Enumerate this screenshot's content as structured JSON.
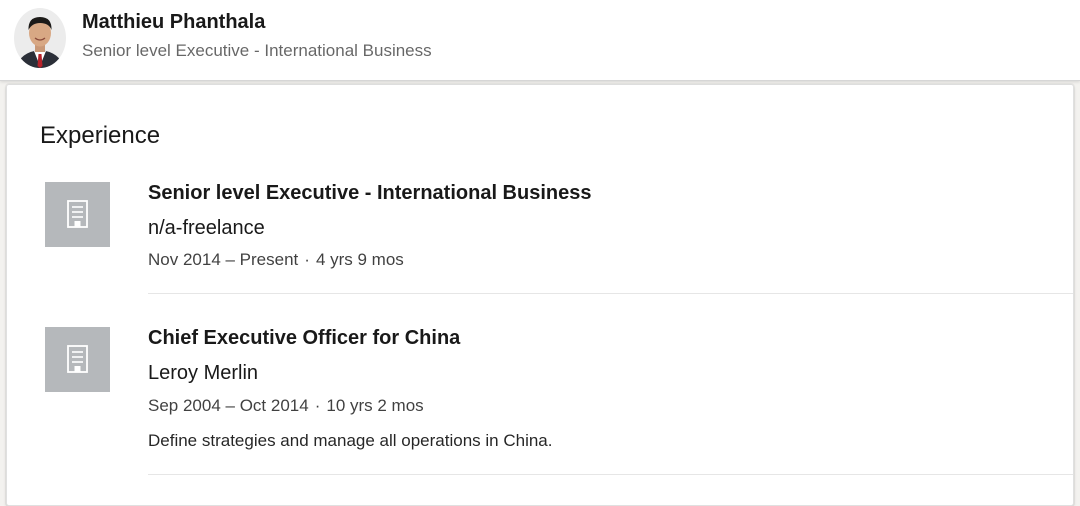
{
  "profile": {
    "name": "Matthieu Phanthala",
    "headline": "Senior level Executive - International Business"
  },
  "experience": {
    "section_title": "Experience",
    "entries": [
      {
        "logo_icon": "building-icon",
        "title": "Senior level Executive - International Business",
        "company": "n/a-freelance",
        "date_range": "Nov 2014 – Present",
        "separator": "·",
        "duration": "4 yrs 9 mos"
      },
      {
        "logo_icon": "building-icon",
        "title": "Chief Executive Officer for China",
        "company": "Leroy Merlin",
        "date_range": "Sep 2004 – Oct 2014",
        "separator": "·",
        "duration": "10 yrs 2 mos",
        "description": "Define strategies and manage all operations in China."
      }
    ]
  },
  "colors": {
    "logo_placeholder": "#b5b8bb",
    "secondary_text": "#666666",
    "divider": "#e6e6e6"
  }
}
